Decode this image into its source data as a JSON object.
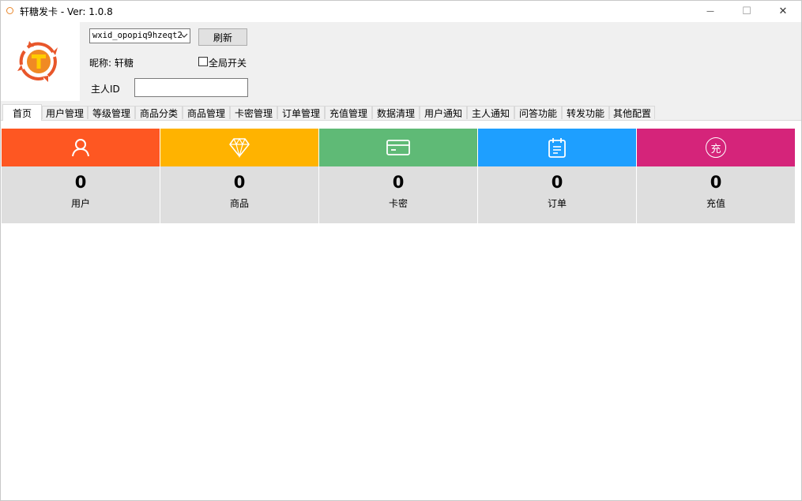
{
  "window": {
    "title": "轩糖发卡 - Ver: 1.0.8",
    "minimize": "—",
    "maximize": "☐",
    "close": "✕"
  },
  "logo": {
    "letter": "T",
    "colors": {
      "primary": "#e8562a",
      "secondary": "#f5a623"
    }
  },
  "account": {
    "selected": "wxid_opopiq9hzeqt2",
    "refresh_label": "刷新",
    "nickname_label": "昵称: 轩糖",
    "global_switch_label": "全局开关",
    "global_switch_checked": false,
    "owner_id_label": "主人ID",
    "owner_id_value": ""
  },
  "tabs": [
    "首页",
    "用户管理",
    "等级管理",
    "商品分类",
    "商品管理",
    "卡密管理",
    "订单管理",
    "充值管理",
    "数据清理",
    "用户通知",
    "主人通知",
    "问答功能",
    "转发功能",
    "其他配置"
  ],
  "active_tab": 0,
  "stats": [
    {
      "icon": "user-icon",
      "value": "0",
      "label": "用户",
      "color": "#fe5722"
    },
    {
      "icon": "diamond-icon",
      "value": "0",
      "label": "商品",
      "color": "#ffb300"
    },
    {
      "icon": "card-icon",
      "value": "0",
      "label": "卡密",
      "color": "#5fba76"
    },
    {
      "icon": "clipboard-icon",
      "value": "0",
      "label": "订单",
      "color": "#1e9fff"
    },
    {
      "icon": "recharge-icon",
      "value": "0",
      "label": "充值",
      "color": "#d5247a",
      "icon_text": "充"
    }
  ]
}
